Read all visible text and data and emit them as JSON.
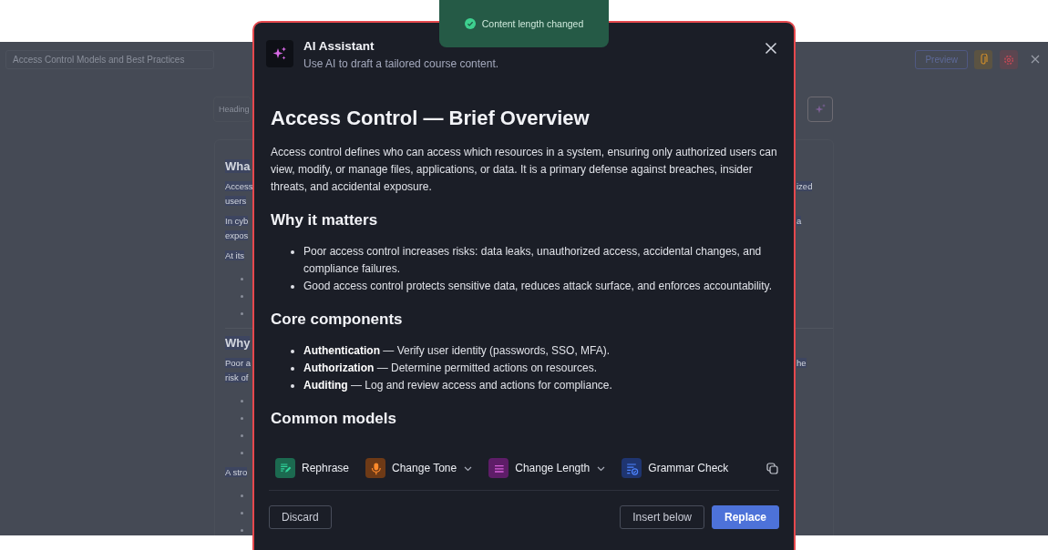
{
  "toast": {
    "text": "Content length changed"
  },
  "background": {
    "title_field": {
      "value": "Access Control Models and Best Practices"
    },
    "preview_button": "Preview",
    "block_type": "Heading",
    "document": [
      {
        "kind": "heading",
        "left": "Wha",
        "divider_above": false
      },
      {
        "kind": "para",
        "left": "Access",
        "right": "ized"
      },
      {
        "kind": "line",
        "left": "users"
      },
      {
        "kind": "para",
        "left": "In cyb",
        "right": "a"
      },
      {
        "kind": "line",
        "left": "expos"
      },
      {
        "kind": "para",
        "left": "At its"
      },
      {
        "kind": "bullet"
      },
      {
        "kind": "bullet"
      },
      {
        "kind": "bullet"
      },
      {
        "kind": "heading",
        "left": "Why",
        "divider_above": true
      },
      {
        "kind": "para",
        "left": "Poor a",
        "right": "he"
      },
      {
        "kind": "line",
        "left": "risk of"
      },
      {
        "kind": "bullet"
      },
      {
        "kind": "bullet"
      },
      {
        "kind": "bullet"
      },
      {
        "kind": "bullet"
      },
      {
        "kind": "para",
        "left": "A stro"
      },
      {
        "kind": "bullet"
      },
      {
        "kind": "bullet"
      },
      {
        "kind": "bullet"
      }
    ]
  },
  "dialog": {
    "title": "AI Assistant",
    "subtitle": "Use AI to draft a tailored course content.",
    "content": [
      {
        "kind": "h1",
        "text": "Access Control — Brief Overview"
      },
      {
        "kind": "p",
        "text": "Access control defines who can access which resources in a system, ensuring only authorized users can view, modify, or manage files, applications, or data. It is a primary defense against breaches, insider threats, and accidental exposure."
      },
      {
        "kind": "h2",
        "text": "Why it matters"
      },
      {
        "kind": "list",
        "items": [
          "Poor access control increases risks: data leaks, unauthorized access, accidental changes, and compliance failures.",
          "Good access control protects sensitive data, reduces attack surface, and enforces accountability."
        ]
      },
      {
        "kind": "h2",
        "text": "Core components"
      },
      {
        "kind": "list",
        "items": [
          "**Authentication** — Verify user identity (passwords, SSO, MFA).",
          "**Authorization** — Determine permitted actions on resources.",
          "**Auditing** — Log and review access and actions for compliance."
        ]
      },
      {
        "kind": "h2",
        "text": "Common models"
      }
    ],
    "actions": [
      {
        "kind": "rephrase",
        "label": "Rephrase",
        "color": "#1c6a50",
        "dropdown": false
      },
      {
        "kind": "tone",
        "label": "Change Tone",
        "color": "#6e3a16",
        "dropdown": true
      },
      {
        "kind": "length",
        "label": "Change Length",
        "color": "#5e1d68",
        "dropdown": true
      },
      {
        "kind": "grammar",
        "label": "Grammar Check",
        "color": "#1f3570",
        "dropdown": false
      }
    ],
    "buttons": [
      {
        "kind": "secondary",
        "label": "Discard"
      },
      {
        "kind": "secondary",
        "label": "Insert below"
      },
      {
        "kind": "primary",
        "label": "Replace"
      }
    ]
  }
}
